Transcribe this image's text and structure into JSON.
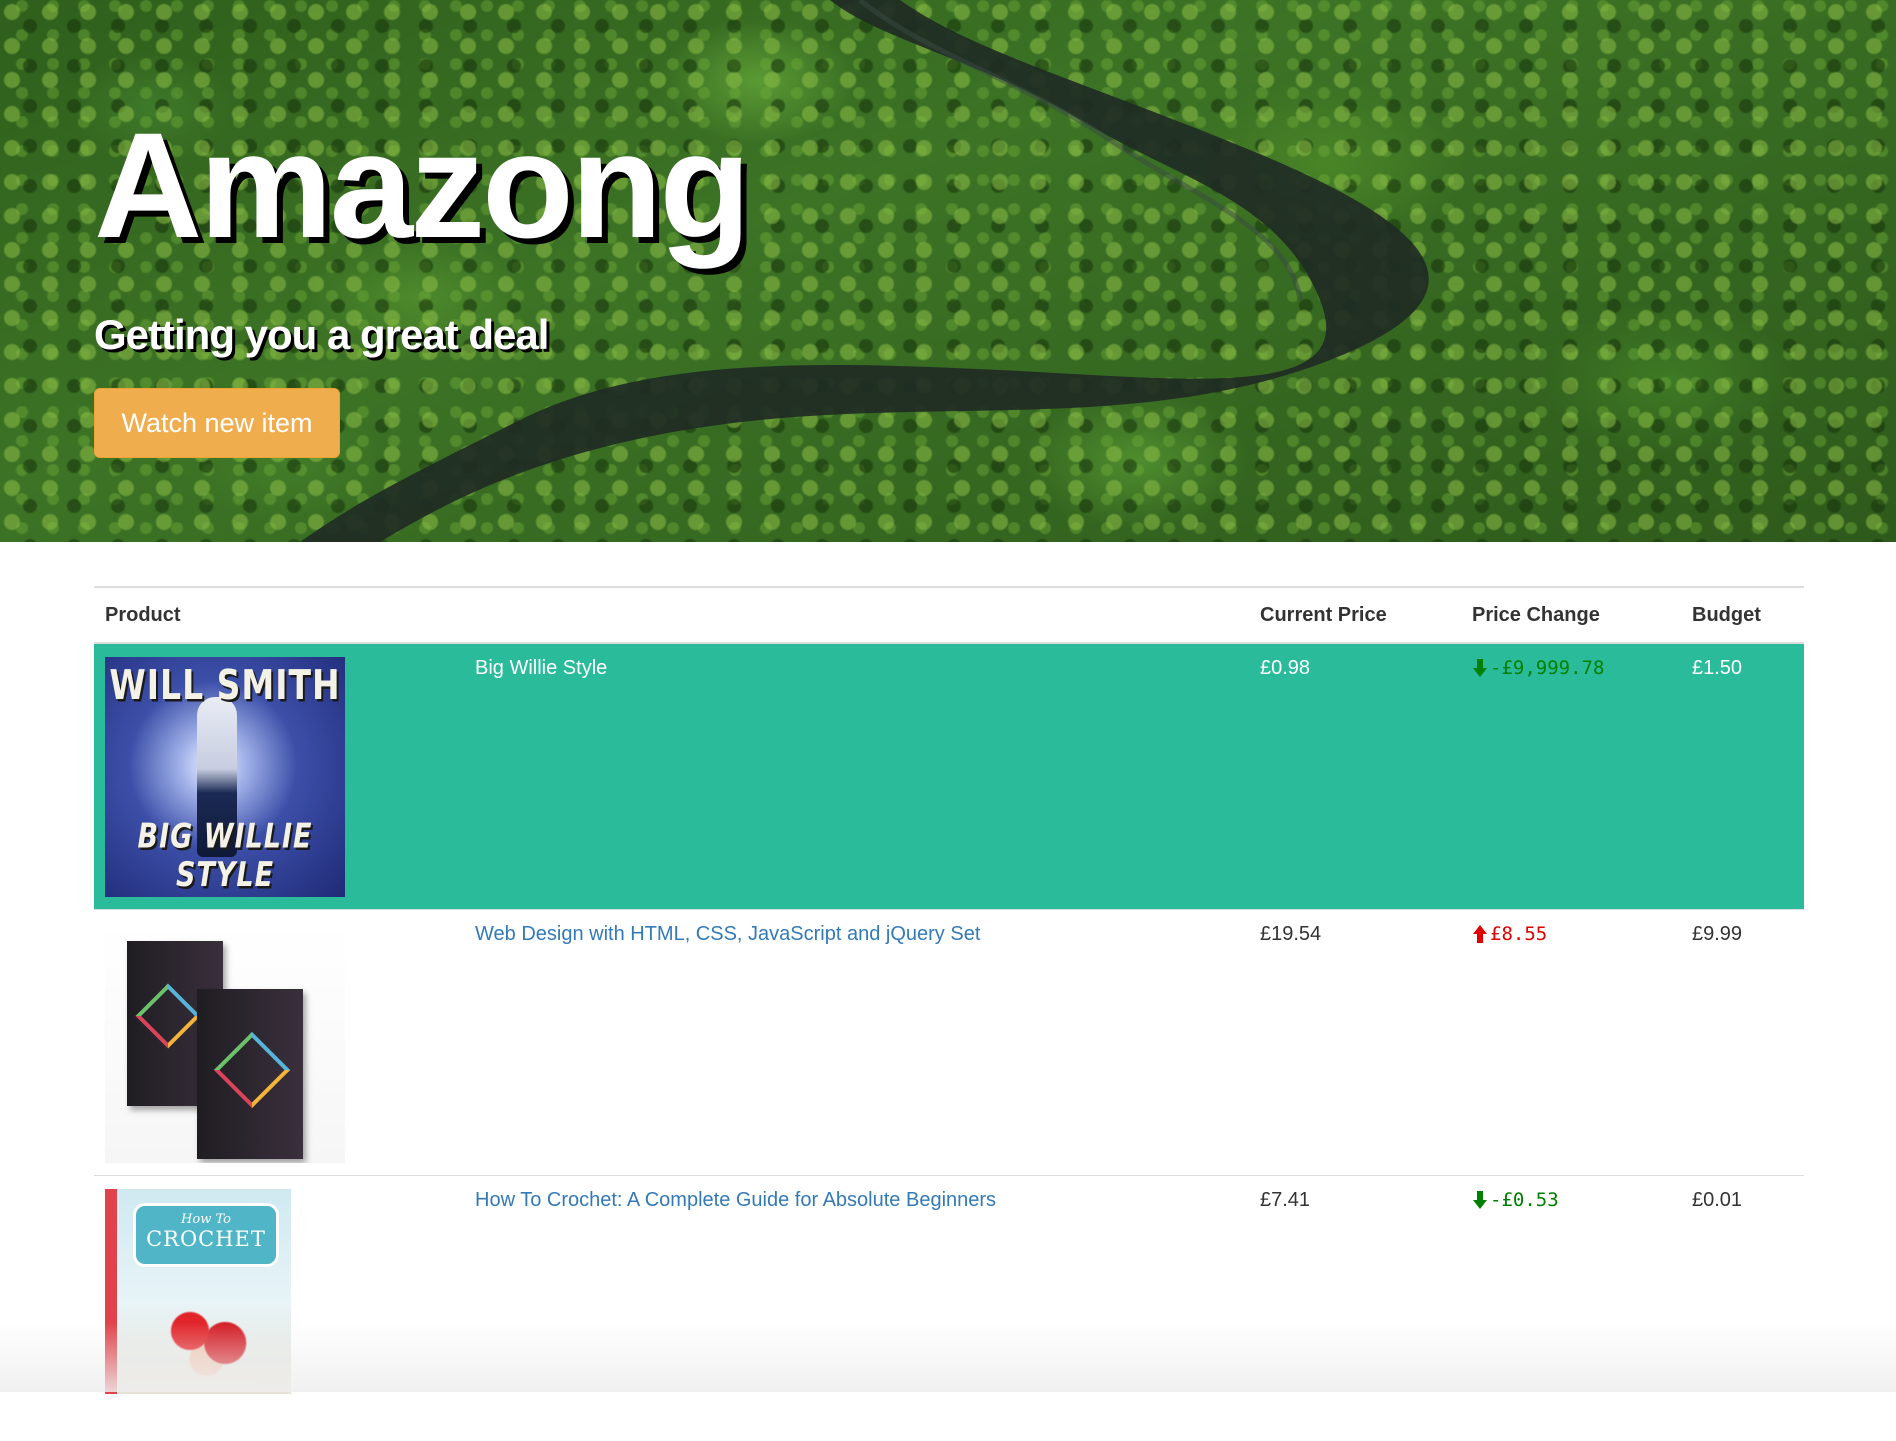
{
  "hero": {
    "title": "Amazong",
    "subtitle": "Getting you a great deal",
    "watch_button_label": "Watch new item"
  },
  "table": {
    "columns": {
      "product": "Product",
      "current_price": "Current Price",
      "price_change": "Price Change",
      "budget": "Budget"
    },
    "rows": [
      {
        "title": "Big Willie Style",
        "current_price": "£0.98",
        "price_change": "-£9,999.78",
        "price_change_direction": "down",
        "budget": "£1.50",
        "highlighted": true,
        "cover": {
          "top_text": "WILL SMITH",
          "bottom_text": "BIG WILLIE STYLE"
        }
      },
      {
        "title": "Web Design with HTML, CSS, JavaScript and jQuery Set",
        "current_price": "£19.54",
        "price_change": "£8.55",
        "price_change_direction": "up",
        "budget": "£9.99",
        "highlighted": false
      },
      {
        "title": "How To Crochet: A Complete Guide for Absolute Beginners",
        "current_price": "£7.41",
        "price_change": "-£0.53",
        "price_change_direction": "down",
        "budget": "£0.01",
        "highlighted": false,
        "cover": {
          "small_text": "How To",
          "big_text": "CROCHET"
        }
      }
    ]
  },
  "colors": {
    "highlight_row": "#2abb9b",
    "button": "#f0ad4e",
    "link": "#337ab7",
    "price_down": "#008000",
    "price_up": "#e00000"
  },
  "icons": {
    "down": "arrow-down-icon",
    "up": "arrow-up-icon"
  }
}
